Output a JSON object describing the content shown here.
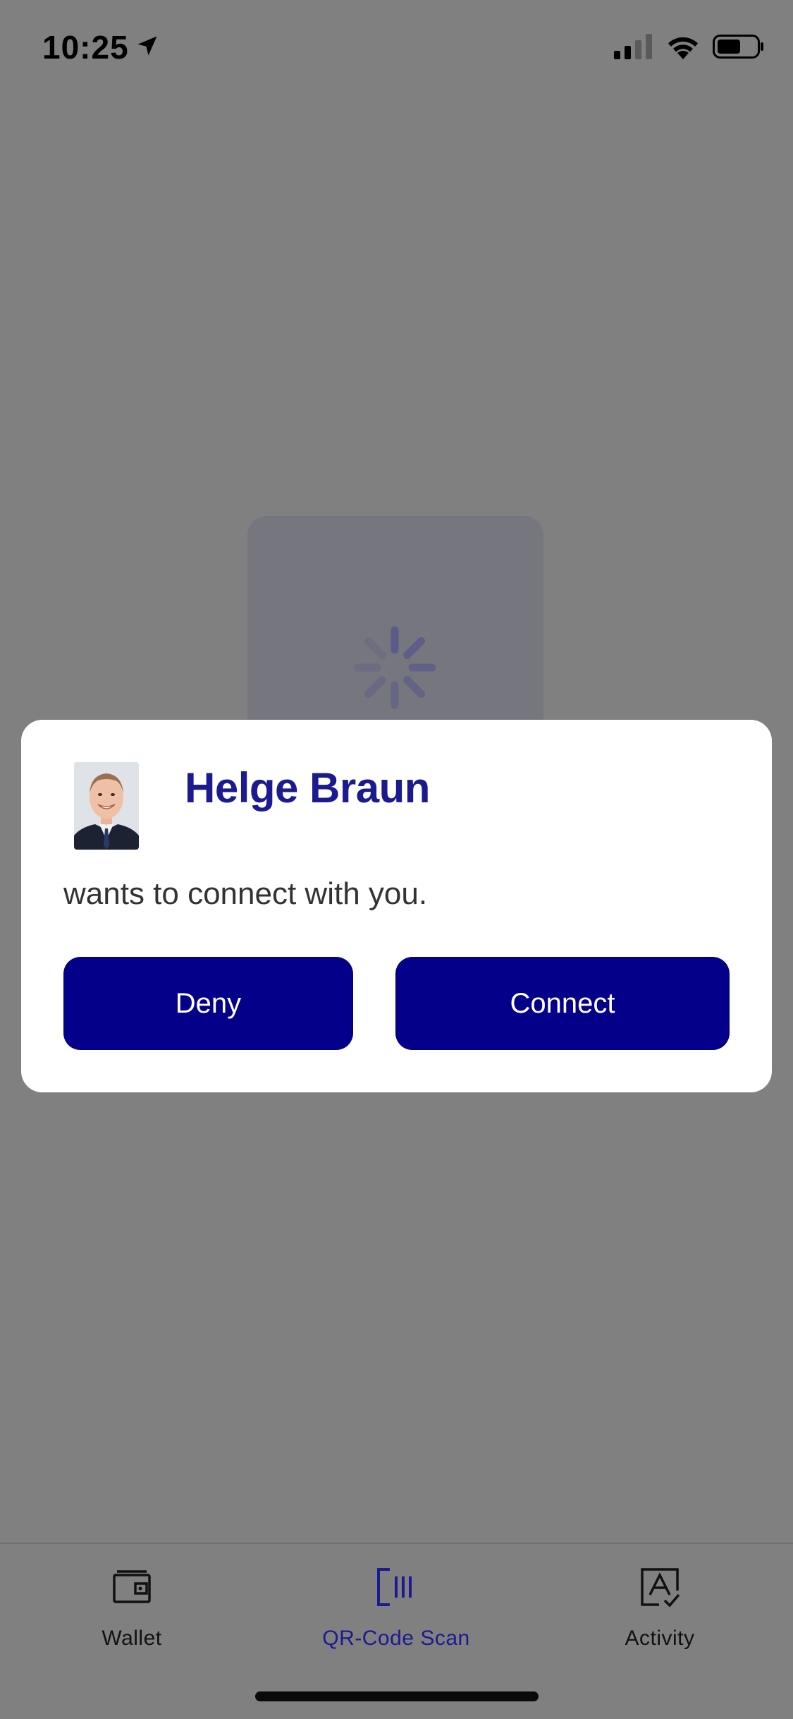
{
  "status_bar": {
    "time": "10:25",
    "location_icon": "location-arrow-icon",
    "signal_icon": "cellular-signal-icon",
    "wifi_icon": "wifi-icon",
    "battery_icon": "battery-icon"
  },
  "loader": {
    "icon": "activity-spinner-icon"
  },
  "dialog": {
    "avatar": "profile-photo",
    "name": "Helge Braun",
    "message": "wants to connect with you.",
    "deny_label": "Deny",
    "connect_label": "Connect"
  },
  "tab_bar": {
    "active_tab": "QR-Code Scan",
    "tabs": [
      {
        "label": "Wallet",
        "icon": "wallet-icon"
      },
      {
        "label": "QR-Code Scan",
        "icon": "qr-scan-icon"
      },
      {
        "label": "Activity",
        "icon": "activity-check-icon"
      }
    ]
  },
  "colors": {
    "overlay": "#808080",
    "primary": "#05008a",
    "name_text": "#1b1b8f",
    "dialog_bg": "#ffffff"
  }
}
